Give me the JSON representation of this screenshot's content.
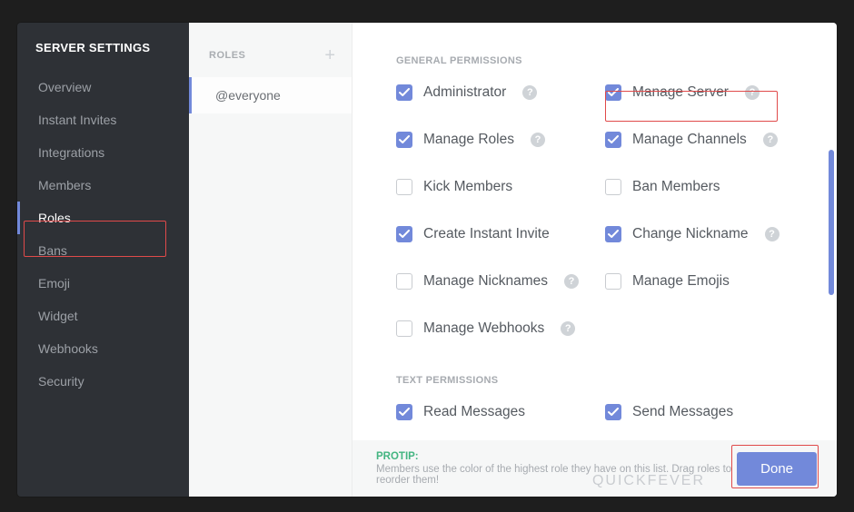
{
  "sidebar": {
    "title": "SERVER SETTINGS",
    "items": [
      {
        "label": "Overview"
      },
      {
        "label": "Instant Invites"
      },
      {
        "label": "Integrations"
      },
      {
        "label": "Members"
      },
      {
        "label": "Roles"
      },
      {
        "label": "Bans"
      },
      {
        "label": "Emoji"
      },
      {
        "label": "Widget"
      },
      {
        "label": "Webhooks"
      },
      {
        "label": "Security"
      }
    ],
    "active_index": 4
  },
  "roles_column": {
    "header": "ROLES",
    "add_icon": "plus-icon",
    "items": [
      {
        "label": "@everyone"
      }
    ],
    "active_index": 0
  },
  "permissions": {
    "sections": [
      {
        "title": "GENERAL PERMISSIONS",
        "items": [
          {
            "label": "Administrator",
            "checked": true,
            "help": true
          },
          {
            "label": "Manage Server",
            "checked": true,
            "help": true
          },
          {
            "label": "Manage Roles",
            "checked": true,
            "help": true
          },
          {
            "label": "Manage Channels",
            "checked": true,
            "help": true
          },
          {
            "label": "Kick Members",
            "checked": false,
            "help": false
          },
          {
            "label": "Ban Members",
            "checked": false,
            "help": false
          },
          {
            "label": "Create Instant Invite",
            "checked": true,
            "help": false
          },
          {
            "label": "Change Nickname",
            "checked": true,
            "help": true
          },
          {
            "label": "Manage Nicknames",
            "checked": false,
            "help": true
          },
          {
            "label": "Manage Emojis",
            "checked": false,
            "help": false
          },
          {
            "label": "Manage Webhooks",
            "checked": false,
            "help": true
          }
        ]
      },
      {
        "title": "TEXT PERMISSIONS",
        "items": [
          {
            "label": "Read Messages",
            "checked": true,
            "help": false
          },
          {
            "label": "Send Messages",
            "checked": true,
            "help": false
          }
        ]
      }
    ]
  },
  "footer": {
    "protip_label": "PROTIP:",
    "protip_text": "Members use the color of the highest role they have on this list. Drag roles to reorder them!",
    "done_label": "Done"
  },
  "watermark": "QUICKFEVER",
  "colors": {
    "accent": "#7289da",
    "success": "#43b581",
    "highlight": "#e04a4a"
  }
}
